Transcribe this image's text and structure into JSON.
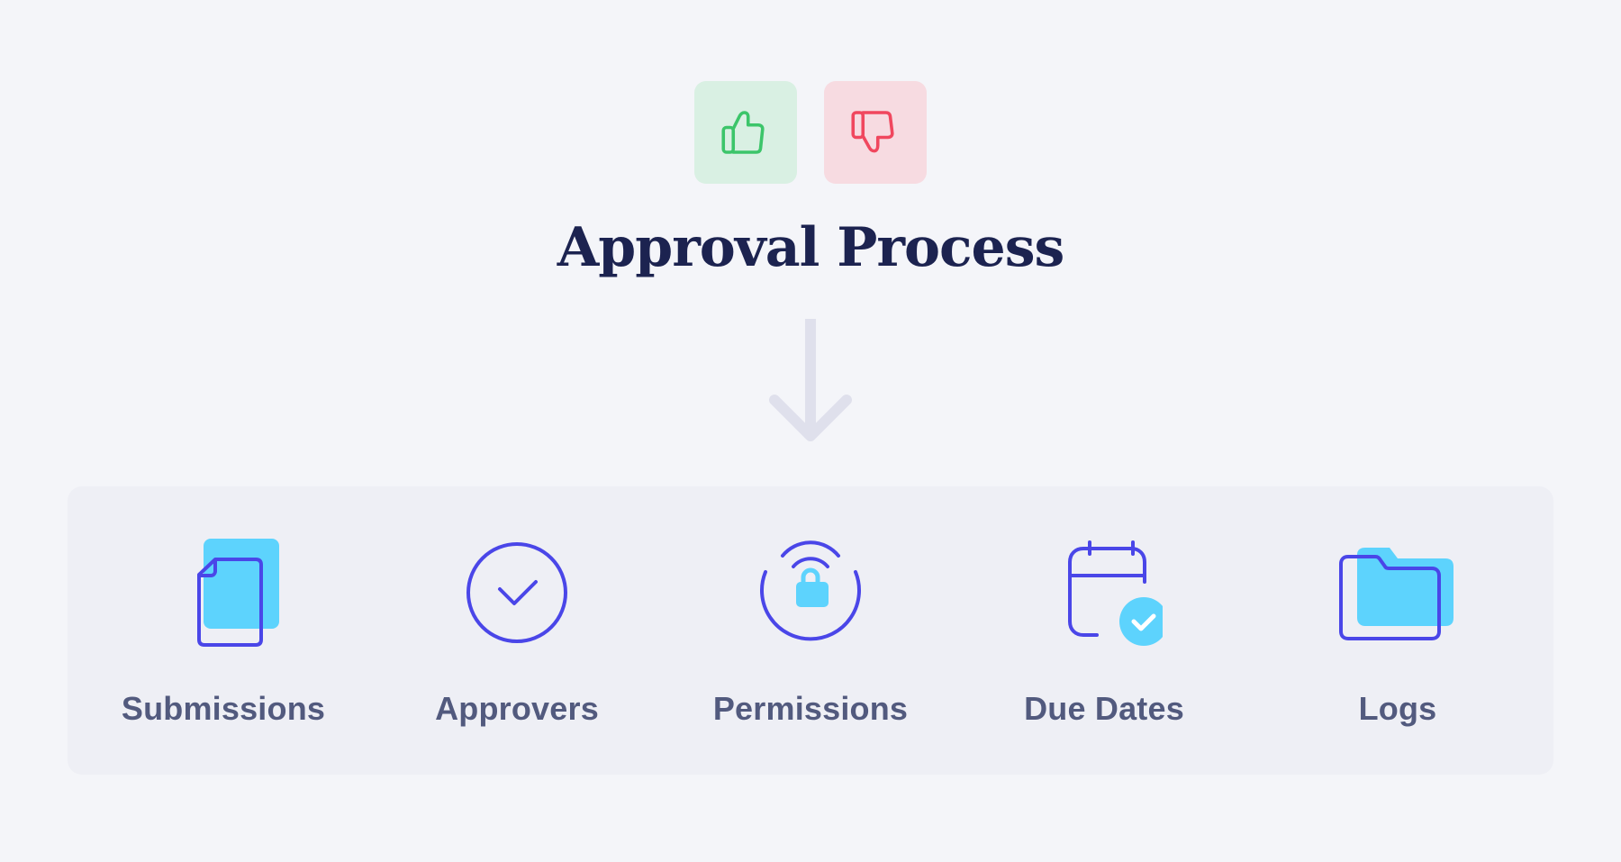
{
  "header": {
    "title": "Approval Process",
    "vote_buttons": [
      {
        "id": "approve",
        "icon": "thumbs-up-icon",
        "color": "#3cc56a",
        "background": "#d9f0e3"
      },
      {
        "id": "reject",
        "icon": "thumbs-down-icon",
        "color": "#f0475e",
        "background": "#f7dbe1"
      }
    ]
  },
  "connector": {
    "icon": "arrow-down-icon",
    "color": "#dfe0ec"
  },
  "colors": {
    "primary_stroke": "#4a46e8",
    "accent_fill": "#5dd3fd",
    "label": "#525a7e",
    "title": "#1c2350"
  },
  "features": [
    {
      "label": "Submissions",
      "icon": "documents-icon"
    },
    {
      "label": "Approvers",
      "icon": "check-circle-icon"
    },
    {
      "label": "Permissions",
      "icon": "lock-signal-icon"
    },
    {
      "label": "Due Dates",
      "icon": "calendar-check-icon"
    },
    {
      "label": "Logs",
      "icon": "folder-icon"
    }
  ]
}
